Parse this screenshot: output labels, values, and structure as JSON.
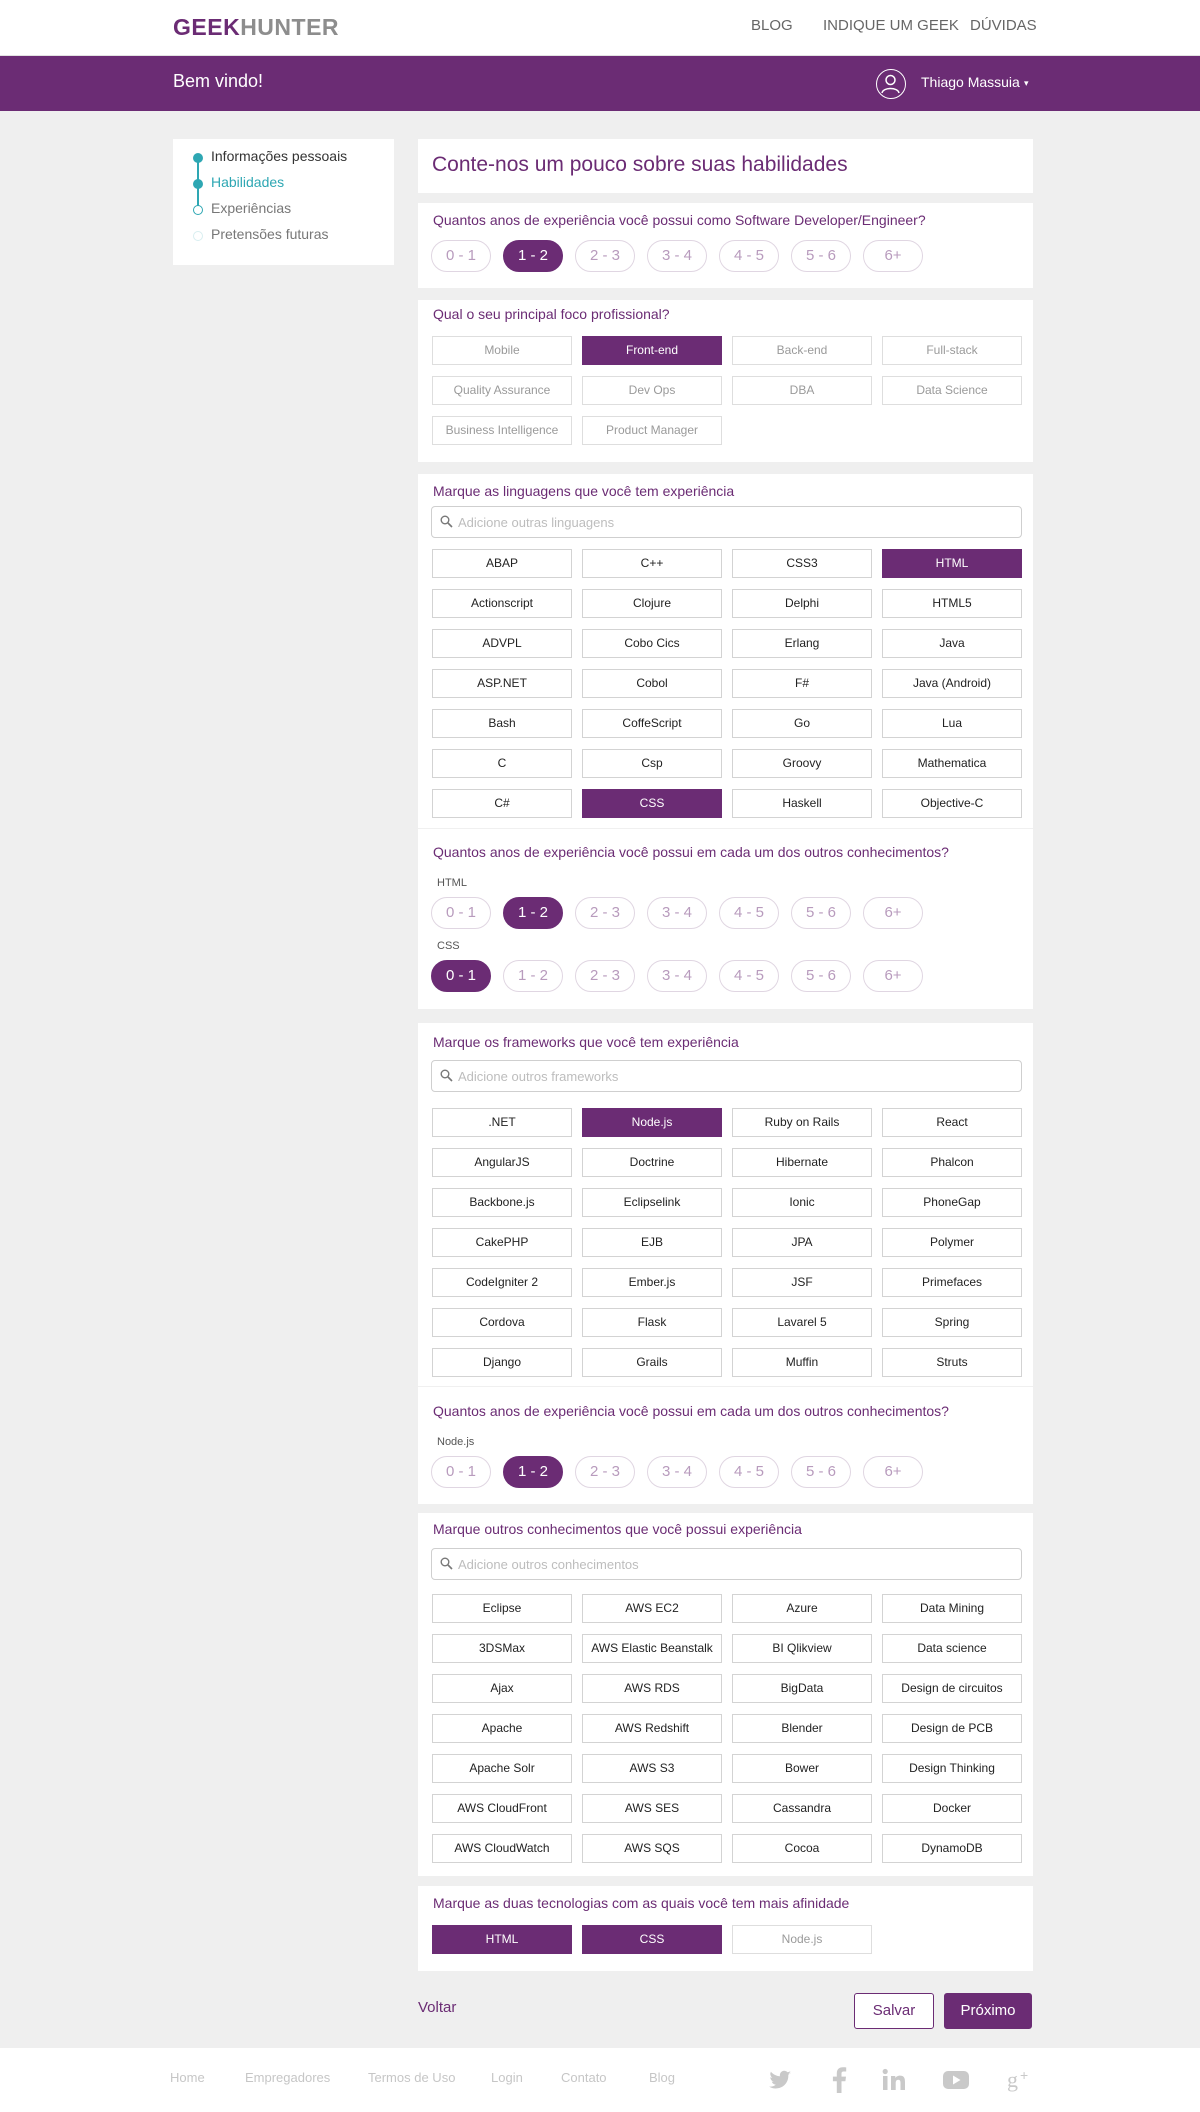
{
  "brand": {
    "logo_part1": "GEEK",
    "logo_part2": "HUNTER",
    "accent": "#6b2c74",
    "teal": "#2ea7b3"
  },
  "topnav": {
    "blog": "BLOG",
    "indique": "INDIQUE UM GEEK",
    "duvidas": "DÚVIDAS"
  },
  "welcome": {
    "message": "Bem vindo!",
    "user_name": "Thiago Massuia",
    "caret": "▾",
    "user_icon": "user-circle-icon"
  },
  "steps": {
    "items": [
      {
        "label": "Informações pessoais",
        "state": "done"
      },
      {
        "label": "Habilidades",
        "state": "active"
      },
      {
        "label": "Experiências",
        "state": "pending"
      },
      {
        "label": "Pretensões futuras",
        "state": "inactive"
      }
    ]
  },
  "main": {
    "title": "Conte-nos um pouco sobre suas habilidades",
    "experience": {
      "question": "Quantos anos de experiência você possui como Software Developer/Engineer?",
      "options": [
        "0 - 1",
        "1 - 2",
        "2 - 3",
        "3 - 4",
        "4 - 5",
        "5 - 6",
        "6+"
      ],
      "selected": "1 - 2"
    },
    "focus": {
      "question": "Qual o seu principal foco profissional?",
      "options": [
        "Mobile",
        "Front-end",
        "Back-end",
        "Full-stack",
        "Quality Assurance",
        "Dev Ops",
        "DBA",
        "Data Science",
        "Business Intelligence",
        "Product Manager"
      ],
      "selected": [
        "Front-end"
      ]
    },
    "languages": {
      "question": "Marque as linguagens que você tem experiência",
      "search_placeholder": "Adicione outras linguagens",
      "options": [
        "ABAP",
        "C++",
        "CSS3",
        "HTML",
        "Actionscript",
        "Clojure",
        "Delphi",
        "HTML5",
        "ADVPL",
        "Cobo Cics",
        "Erlang",
        "Java",
        "ASP.NET",
        "Cobol",
        "F#",
        "Java (Android)",
        "Bash",
        "CoffeScript",
        "Go",
        "Lua",
        "C",
        "Csp",
        "Groovy",
        "Mathematica",
        "C#",
        "CSS",
        "Haskell",
        "Objective-C"
      ],
      "selected": [
        "HTML",
        "CSS"
      ]
    },
    "lang_years": {
      "question": "Quantos anos de experiência você possui em cada um dos outros conhecimentos?",
      "groups": [
        {
          "label": "HTML",
          "selected": "1 - 2"
        },
        {
          "label": "CSS",
          "selected": "0 - 1"
        }
      ]
    },
    "frameworks": {
      "question": "Marque os frameworks que você tem experiência",
      "search_placeholder": "Adicione outros frameworks",
      "options": [
        ".NET",
        "Node.js",
        "Ruby on Rails",
        "React",
        "AngularJS",
        "Doctrine",
        "Hibernate",
        "Phalcon",
        "Backbone.js",
        "Eclipselink",
        "Ionic",
        "PhoneGap",
        "CakePHP",
        "EJB",
        "JPA",
        "Polymer",
        "CodeIgniter 2",
        "Ember.js",
        "JSF",
        "Primefaces",
        "Cordova",
        "Flask",
        "Lavarel 5",
        "Spring",
        "Django",
        "Grails",
        "Muffin",
        "Struts"
      ],
      "selected": [
        "Node.js"
      ]
    },
    "fw_years": {
      "question": "Quantos anos de experiência você possui em cada um dos outros conhecimentos?",
      "groups": [
        {
          "label": "Node.js",
          "selected": "1 - 2"
        }
      ]
    },
    "others": {
      "question": "Marque outros conhecimentos que você possui experiência",
      "search_placeholder": "Adicione outros conhecimentos",
      "options": [
        "Eclipse",
        "AWS EC2",
        "Azure",
        "Data Mining",
        "3DSMax",
        "AWS Elastic Beanstalk",
        "BI Qlikview",
        "Data science",
        "Ajax",
        "AWS RDS",
        "BigData",
        "Design de circuitos",
        "Apache",
        "AWS Redshift",
        "Blender",
        "Design de PCB",
        "Apache Solr",
        "AWS S3",
        "Bower",
        "Design Thinking",
        "AWS CloudFront",
        "AWS SES",
        "Cassandra",
        "Docker",
        "AWS CloudWatch",
        "AWS SQS",
        "Cocoa",
        "DynamoDB"
      ],
      "selected": []
    },
    "affinity": {
      "question": "Marque as duas tecnologias com as quais você tem mais afinidade",
      "options": [
        "HTML",
        "CSS",
        "Node.js"
      ],
      "selected": [
        "HTML",
        "CSS"
      ]
    }
  },
  "actions": {
    "back": "Voltar",
    "save": "Salvar",
    "next": "Próximo"
  },
  "footer": {
    "links": [
      "Home",
      "Empregadores",
      "Termos de Uso",
      "Login",
      "Contato",
      "Blog"
    ],
    "social_icons": [
      "twitter-icon",
      "facebook-icon",
      "linkedin-icon",
      "youtube-icon",
      "google-plus-icon"
    ]
  }
}
